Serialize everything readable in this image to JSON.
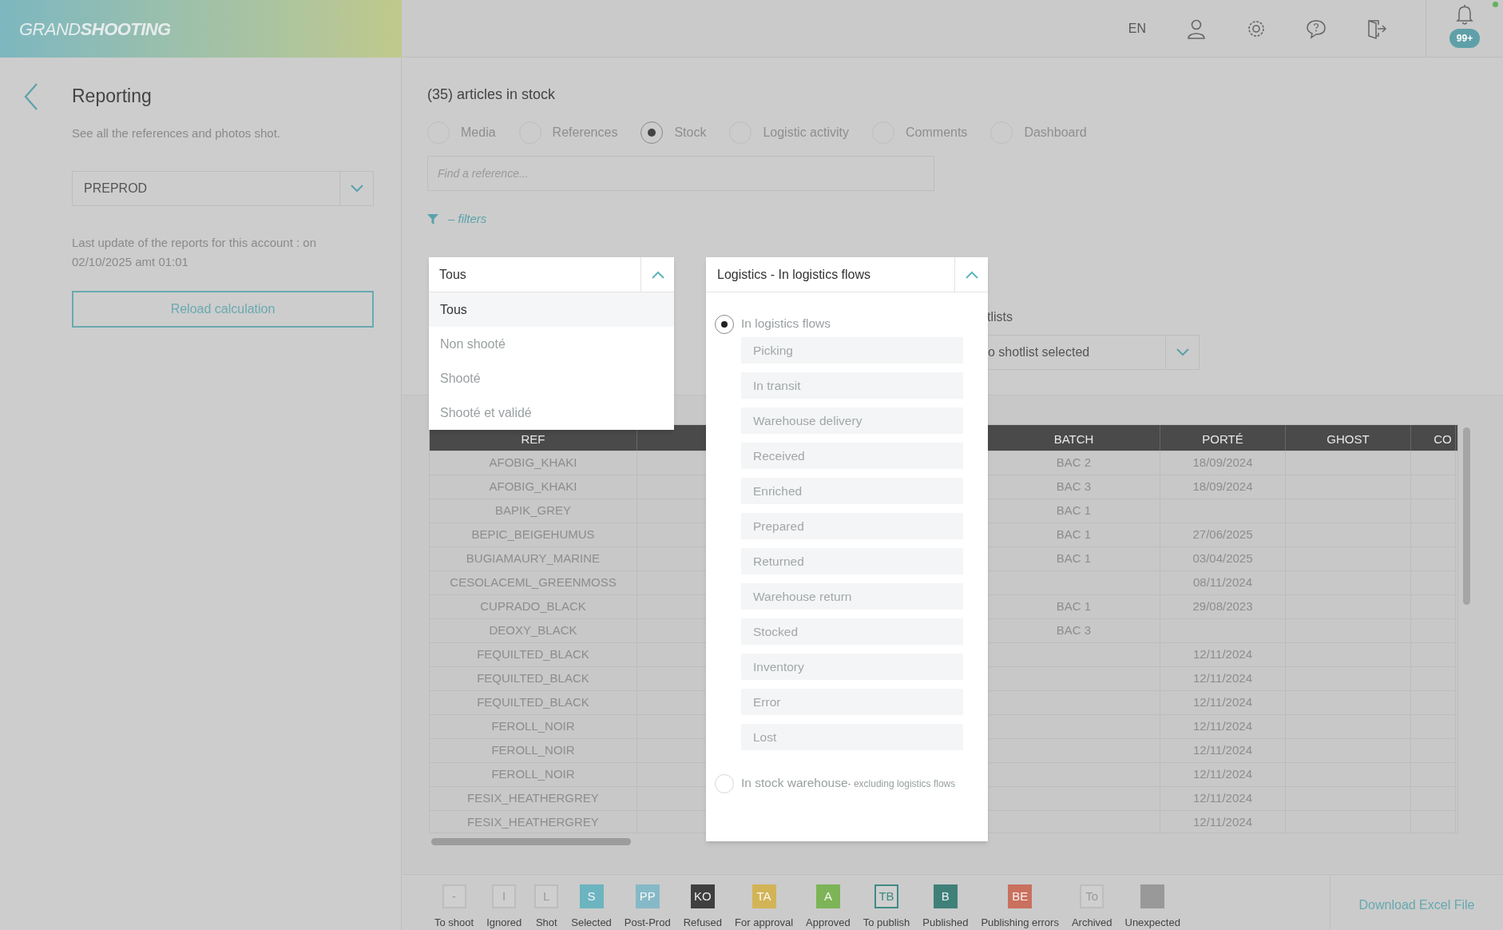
{
  "header": {
    "logo_light": "GRAND",
    "logo_bold": "SHOOTING",
    "language": "EN",
    "notification_count": "99+"
  },
  "sidebar": {
    "title": "Reporting",
    "subtitle": "See all the references and photos shot.",
    "account_select": "PREPROD",
    "last_update": "Last update of the reports for this account : on 02/10/2025 amt 01:01",
    "reload_button": "Reload calculation"
  },
  "main": {
    "heading": "(35) articles in stock",
    "views": [
      {
        "label": "Media",
        "selected": false
      },
      {
        "label": "References",
        "selected": false
      },
      {
        "label": "Stock",
        "selected": true
      },
      {
        "label": "Logistic activity",
        "selected": false
      },
      {
        "label": "Comments",
        "selected": false
      },
      {
        "label": "Dashboard",
        "selected": false
      }
    ],
    "search": {
      "placeholder": "Find a reference..."
    },
    "filters_toggle": "– filters",
    "shotlists_label": "tlists",
    "shotlist_select": "o shotlist selected",
    "status_dropdown": {
      "value": "Tous",
      "options": [
        {
          "label": "Tous",
          "selected": true
        },
        {
          "label": "Non shooté",
          "selected": false
        },
        {
          "label": "Shooté",
          "selected": false
        },
        {
          "label": "Shooté et validé",
          "selected": false
        }
      ]
    },
    "logistics_dropdown": {
      "value": "Logistics - In logistics flows",
      "groups": [
        {
          "label": "In logistics flows",
          "selected": true,
          "steps": [
            "Picking",
            "In transit",
            "Warehouse delivery",
            "Received",
            "Enriched",
            "Prepared",
            "Returned",
            "Warehouse return",
            "Stocked",
            "Inventory",
            "Error",
            "Lost"
          ]
        },
        {
          "label": "In stock warehouse",
          "note": "- excluding logistics flows",
          "selected": false
        }
      ]
    },
    "table": {
      "columns": [
        "REF",
        "BATCH",
        "PORTÉ",
        "GHOST",
        "CO"
      ],
      "rows": [
        [
          "AFOBIG_KHAKI",
          "BAC 2",
          "18/09/2024"
        ],
        [
          "AFOBIG_KHAKI",
          "BAC 3",
          "18/09/2024"
        ],
        [
          "BAPIK_GREY",
          "BAC 1",
          ""
        ],
        [
          "BEPIC_BEIGEHUMUS",
          "BAC 1",
          "27/06/2025"
        ],
        [
          "BUGIAMAURY_MARINE",
          "BAC 1",
          "03/04/2025"
        ],
        [
          "CESOLACEML_GREENMOSS",
          "",
          "08/11/2024"
        ],
        [
          "CUPRADO_BLACK",
          "BAC 1",
          "29/08/2023"
        ],
        [
          "DEOXY_BLACK",
          "BAC 3",
          ""
        ],
        [
          "FEQUILTED_BLACK",
          "",
          "12/11/2024"
        ],
        [
          "FEQUILTED_BLACK",
          "",
          "12/11/2024"
        ],
        [
          "FEQUILTED_BLACK",
          "",
          "12/11/2024"
        ],
        [
          "FEROLL_NOIR",
          "",
          "12/11/2024"
        ],
        [
          "FEROLL_NOIR",
          "",
          "12/11/2024"
        ],
        [
          "FEROLL_NOIR",
          "",
          "12/11/2024"
        ],
        [
          "FESIX_HEATHERGREY",
          "",
          "12/11/2024"
        ],
        [
          "FESIX_HEATHERGREY",
          "",
          "12/11/2024"
        ]
      ]
    }
  },
  "legend": [
    {
      "code": "-",
      "label": "To shoot",
      "kind": "outline",
      "color": "#bdbdbd"
    },
    {
      "code": "I",
      "label": "Ignored",
      "kind": "outline",
      "color": "#bdbdbd"
    },
    {
      "code": "L",
      "label": "Shot",
      "kind": "outline",
      "color": "#bdbdbd"
    },
    {
      "code": "S",
      "label": "Selected",
      "kind": "filled",
      "color": "#6cb4bf"
    },
    {
      "code": "PP",
      "label": "Post-Prod",
      "kind": "filled",
      "color": "#86b9c7"
    },
    {
      "code": "KO",
      "label": "Refused",
      "kind": "filled",
      "color": "#3f3f3f"
    },
    {
      "code": "TA",
      "label": "For approval",
      "kind": "filled",
      "color": "#d2b457"
    },
    {
      "code": "A",
      "label": "Approved",
      "kind": "filled",
      "color": "#7db457"
    },
    {
      "code": "TB",
      "label": "To publish",
      "kind": "outline",
      "color": "#3f8a85"
    },
    {
      "code": "B",
      "label": "Published",
      "kind": "filled",
      "color": "#3f8079"
    },
    {
      "code": "BE",
      "label": "Publishing errors",
      "kind": "filled",
      "color": "#c9705f"
    },
    {
      "code": "To",
      "label": "Archived",
      "kind": "outline",
      "color": "#bdbdbd"
    },
    {
      "label": "Unexpected",
      "kind": "filled",
      "color": "#999999"
    }
  ],
  "download_link": "Download Excel File"
}
